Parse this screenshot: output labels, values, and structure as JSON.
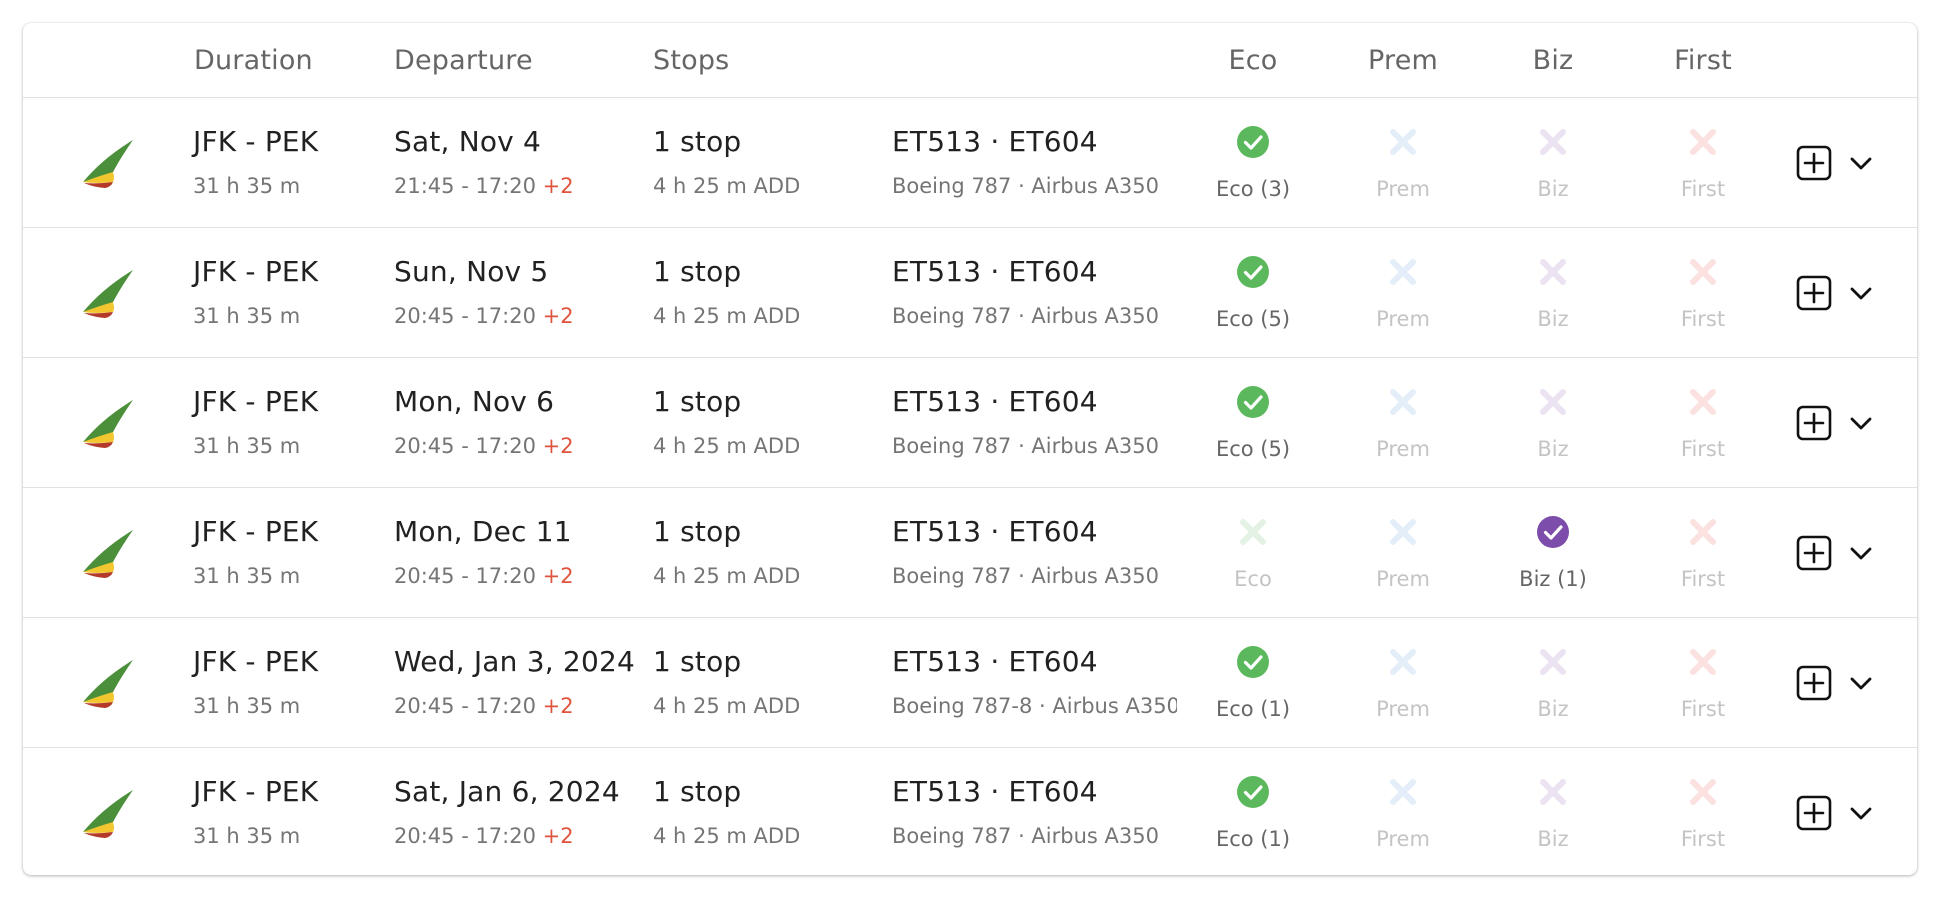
{
  "header": {
    "duration": "Duration",
    "departure": "Departure",
    "stops": "Stops",
    "eco": "Eco",
    "prem": "Prem",
    "biz": "Biz",
    "first": "First"
  },
  "colors": {
    "eco_available": "#5cb85c",
    "biz_available": "#7c4daa",
    "eco_unavailable": "#e3f2e3",
    "prem_unavailable": "#e3eef8",
    "biz_unavailable": "#ece3f2",
    "first_unavailable": "#fbe2e0",
    "day_offset": "#e0533d"
  },
  "icons": {
    "available": "check-circle-icon",
    "unavailable": "x-icon",
    "add": "plus-square-icon",
    "expand": "chevron-down-icon",
    "airline": "airline-logo-icon"
  },
  "rows": [
    {
      "route": "JFK - PEK",
      "duration": "31 h 35 m",
      "date": "Sat, Nov 4",
      "times": "21:45 - 17:20",
      "day_offset": "+2",
      "stops": "1 stop",
      "layover": "4 h 25 m  ADD",
      "flights": "ET513  ·  ET604",
      "aircraft": "Boeing 787  ·  Airbus A350",
      "eco": "Eco (3)",
      "prem": "Prem",
      "biz": "Biz",
      "first": "First"
    },
    {
      "route": "JFK - PEK",
      "duration": "31 h 35 m",
      "date": "Sun, Nov 5",
      "times": "20:45 - 17:20",
      "day_offset": "+2",
      "stops": "1 stop",
      "layover": "4 h 25 m  ADD",
      "flights": "ET513  ·  ET604",
      "aircraft": "Boeing 787  ·  Airbus A350",
      "eco": "Eco (5)",
      "prem": "Prem",
      "biz": "Biz",
      "first": "First"
    },
    {
      "route": "JFK - PEK",
      "duration": "31 h 35 m",
      "date": "Mon, Nov 6",
      "times": "20:45 - 17:20",
      "day_offset": "+2",
      "stops": "1 stop",
      "layover": "4 h 25 m  ADD",
      "flights": "ET513  ·  ET604",
      "aircraft": "Boeing 787  ·  Airbus A350",
      "eco": "Eco (5)",
      "prem": "Prem",
      "biz": "Biz",
      "first": "First"
    },
    {
      "route": "JFK - PEK",
      "duration": "31 h 35 m",
      "date": "Mon, Dec 11",
      "times": "20:45 - 17:20",
      "day_offset": "+2",
      "stops": "1 stop",
      "layover": "4 h 25 m  ADD",
      "flights": "ET513  ·  ET604",
      "aircraft": "Boeing 787  ·  Airbus A350",
      "eco": "Eco",
      "prem": "Prem",
      "biz": "Biz (1)",
      "first": "First"
    },
    {
      "route": "JFK - PEK",
      "duration": "31 h 35 m",
      "date": "Wed, Jan 3, 2024",
      "times": "20:45 - 17:20",
      "day_offset": "+2",
      "stops": "1 stop",
      "layover": "4 h 25 m  ADD",
      "flights": "ET513  ·  ET604",
      "aircraft": "Boeing 787-8  ·  Airbus A350",
      "eco": "Eco (1)",
      "prem": "Prem",
      "biz": "Biz",
      "first": "First"
    },
    {
      "route": "JFK - PEK",
      "duration": "31 h 35 m",
      "date": "Sat, Jan 6, 2024",
      "times": "20:45 - 17:20",
      "day_offset": "+2",
      "stops": "1 stop",
      "layover": "4 h 25 m  ADD",
      "flights": "ET513  ·  ET604",
      "aircraft": "Boeing 787  ·  Airbus A350",
      "eco": "Eco (1)",
      "prem": "Prem",
      "biz": "Biz",
      "first": "First"
    }
  ]
}
